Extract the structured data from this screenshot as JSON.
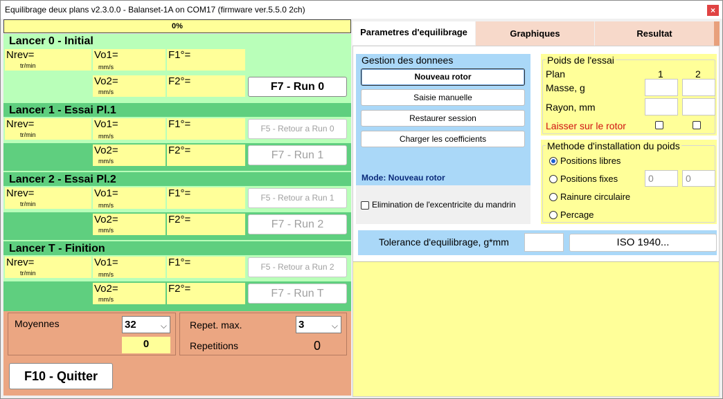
{
  "window": {
    "title": "Equilibrage deux plans v2.3.0.0 - Balanset-1A on COM17 (firmware ver.5.5.0 2ch)",
    "close_icon": "×"
  },
  "progress": {
    "text": "0%",
    "value": 0
  },
  "runs": [
    {
      "title": "Lancer 0 - Initial",
      "nrev": "Nrev=",
      "nrev_unit": "tr/min",
      "vo1": "Vo1=",
      "vo2": "Vo2=",
      "unit": "mm/s",
      "f1": "F1°=",
      "f2": "F2°=",
      "btn_run": "F7 - Run 0"
    },
    {
      "title": "Lancer 1 - Essai Pl.1",
      "nrev": "Nrev=",
      "nrev_unit": "tr/min",
      "vo1": "Vo1=",
      "vo2": "Vo2=",
      "unit": "mm/s",
      "f1": "F1°=",
      "f2": "F2°=",
      "btn_back": "F5 - Retour a Run 0",
      "btn_run": "F7 - Run 1"
    },
    {
      "title": "Lancer 2 - Essai Pl.2",
      "nrev": "Nrev=",
      "nrev_unit": "tr/min",
      "vo1": "Vo1=",
      "vo2": "Vo2=",
      "unit": "mm/s",
      "f1": "F1°=",
      "f2": "F2°=",
      "btn_back": "F5 - Retour a Run 1",
      "btn_run": "F7 - Run 2"
    },
    {
      "title": "Lancer T - Finition",
      "nrev": "Nrev=",
      "nrev_unit": "tr/min",
      "vo1": "Vo1=",
      "vo2": "Vo2=",
      "unit": "mm/s",
      "f1": "F1°=",
      "f2": "F2°=",
      "btn_back": "F5 - Retour a Run 2",
      "btn_run": "F7 - Run T"
    }
  ],
  "bottom": {
    "moyennes_label": "Moyennes",
    "moyennes_value": "32",
    "moyennes_count": "0",
    "repet_label": "Repet. max.",
    "repet_value": "3",
    "repetitions_label": "Repetitions",
    "repetitions_value": "0",
    "quit_label": "F10 - Quitter"
  },
  "tabs": [
    "Parametres d'equilibrage",
    "Graphiques",
    "Resultat"
  ],
  "gestion": {
    "title": "Gestion des donnees",
    "buttons": [
      "Nouveau rotor",
      "Saisie manuelle",
      "Restaurer session",
      "Charger les coefficients"
    ],
    "mode": "Mode: Nouveau rotor",
    "elimination": "Elimination de l'excentricite du mandrin"
  },
  "poids": {
    "title": "Poids de l'essai",
    "plan": "Plan",
    "plan1": "1",
    "plan2": "2",
    "masse": "Masse, g",
    "rayon": "Rayon, mm",
    "laisser": "Laisser sur le rotor"
  },
  "methode": {
    "title": "Methode d'installation du poids",
    "options": [
      "Positions libres",
      "Positions fixes",
      "Rainure circulaire",
      "Percage"
    ],
    "fixed1": "0",
    "fixed2": "0"
  },
  "tolerance": {
    "label": "Tolerance d'equilibrage, g*mm",
    "iso_button": "ISO 1940..."
  },
  "colors": {
    "section_green": "#b9ffb9",
    "band_green": "#5fcf7f",
    "field_yellow": "#ffff99",
    "bottom_salmon": "#eba682",
    "tab_peach": "#f7d9ca",
    "panel_blue": "#aad8f8",
    "close_red": "#e04343"
  }
}
